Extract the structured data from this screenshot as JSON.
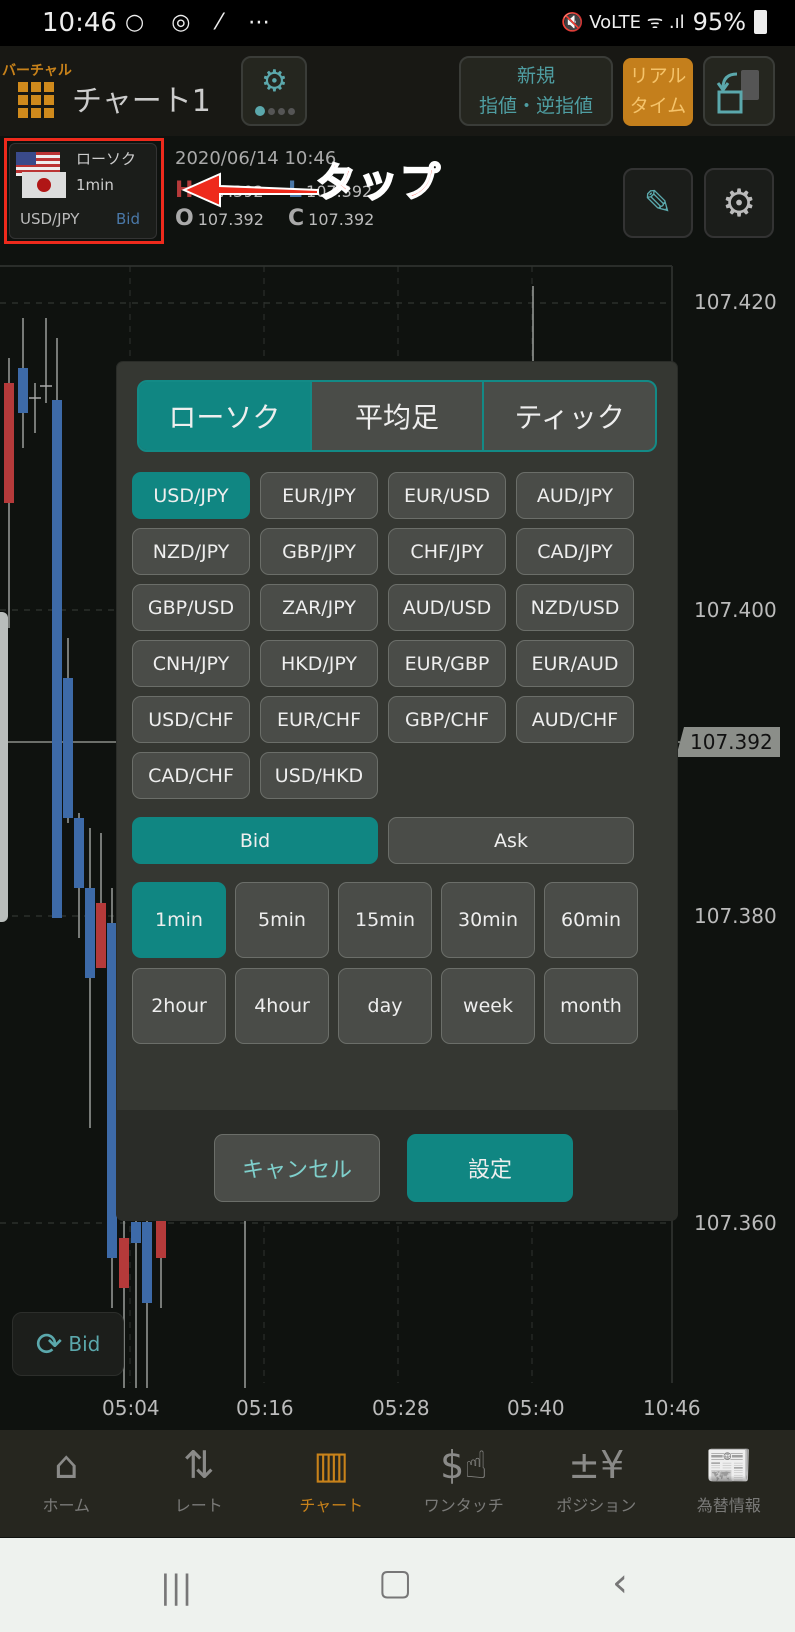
{
  "status_bar": {
    "time": "10:46",
    "left_icons": [
      "notification-dot-icon",
      "messenger-icon",
      "tool-icon",
      "more-icon"
    ],
    "left_glyphs": "○ ◎ ⁄ ⋯",
    "battery": "95%",
    "right_glyphs": "🔇 VoLTE ᯤ .ıl"
  },
  "header": {
    "mode_label": "バーチャル",
    "title": "チャート1",
    "new_order_line1": "新規",
    "new_order_line2": "指値・逆指値",
    "realtime_line1": "リアル",
    "realtime_line2": "タイム",
    "layout_page": 1,
    "layout_pages": 4
  },
  "symbol": {
    "chart_type": "ローソク",
    "timeframe": "1min",
    "pair": "USD/JPY",
    "side": "Bid"
  },
  "quote": {
    "datetime": "2020/06/14 10:46",
    "H_label": "H",
    "H": "107.392",
    "L_label": "L",
    "L": "107.392",
    "O_label": "O",
    "O": "107.392",
    "C_label": "C",
    "C": "107.392"
  },
  "annotation": {
    "text": "タップ"
  },
  "chart": {
    "price_labels": [
      "107.420",
      "107.400",
      "107.380",
      "107.360"
    ],
    "current_price": "107.392",
    "time_labels": [
      "05:04",
      "05:16",
      "05:28",
      "05:40",
      "10:46"
    ],
    "bid_toggle_label": "Bid",
    "up_color": "#b53a3a",
    "down_color": "#3d6aa8"
  },
  "modal": {
    "chart_types": [
      {
        "label": "ローソク",
        "active": true
      },
      {
        "label": "平均足",
        "active": false
      },
      {
        "label": "ティック",
        "active": false
      }
    ],
    "pairs": [
      {
        "label": "USD/JPY",
        "active": true
      },
      {
        "label": "EUR/JPY"
      },
      {
        "label": "EUR/USD"
      },
      {
        "label": "AUD/JPY"
      },
      {
        "label": "NZD/JPY"
      },
      {
        "label": "GBP/JPY"
      },
      {
        "label": "CHF/JPY"
      },
      {
        "label": "CAD/JPY"
      },
      {
        "label": "GBP/USD"
      },
      {
        "label": "ZAR/JPY"
      },
      {
        "label": "AUD/USD"
      },
      {
        "label": "NZD/USD"
      },
      {
        "label": "CNH/JPY"
      },
      {
        "label": "HKD/JPY"
      },
      {
        "label": "EUR/GBP"
      },
      {
        "label": "EUR/AUD"
      },
      {
        "label": "USD/CHF"
      },
      {
        "label": "EUR/CHF"
      },
      {
        "label": "GBP/CHF"
      },
      {
        "label": "AUD/CHF"
      },
      {
        "label": "CAD/CHF"
      },
      {
        "label": "USD/HKD"
      }
    ],
    "sides": [
      {
        "label": "Bid",
        "active": true
      },
      {
        "label": "Ask",
        "active": false
      }
    ],
    "timeframes": [
      {
        "label": "1min",
        "active": true
      },
      {
        "label": "5min"
      },
      {
        "label": "15min"
      },
      {
        "label": "30min"
      },
      {
        "label": "60min"
      },
      {
        "label": "2hour"
      },
      {
        "label": "4hour"
      },
      {
        "label": "day"
      },
      {
        "label": "week"
      },
      {
        "label": "month"
      }
    ],
    "cancel_label": "キャンセル",
    "ok_label": "設定",
    "accent_color": "#108682"
  },
  "bottom_nav": [
    {
      "label": "ホーム",
      "icon": "home-icon",
      "glyph": "⌂",
      "active": false
    },
    {
      "label": "レート",
      "icon": "rate-arrows-icon",
      "glyph": "⇅",
      "active": false
    },
    {
      "label": "チャート",
      "icon": "candlestick-icon",
      "glyph": "▥",
      "active": true
    },
    {
      "label": "ワンタッチ",
      "icon": "one-touch-icon",
      "glyph": "$☝",
      "active": false
    },
    {
      "label": "ポジション",
      "icon": "position-icon",
      "glyph": "±¥",
      "active": false
    },
    {
      "label": "為替情報",
      "icon": "news-icon",
      "glyph": "📰",
      "active": false
    }
  ],
  "android_nav": {
    "recent": "|||",
    "home": "▢",
    "back": "‹"
  }
}
